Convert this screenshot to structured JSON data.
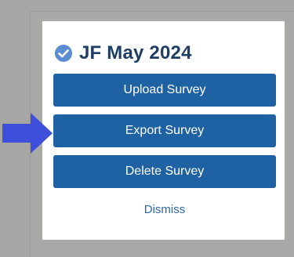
{
  "dialog": {
    "title": "JF May 2024",
    "buttons": {
      "upload": "Upload Survey",
      "export": "Export Survey",
      "delete": "Delete Survey"
    },
    "dismiss": "Dismiss"
  },
  "colors": {
    "button_bg": "#1e62a4",
    "title_text": "#1f3e66",
    "check_icon": "#5b8bd1",
    "pointer_arrow": "#3d4fdb"
  },
  "icons": {
    "title_icon": "check-circle-icon",
    "pointer": "arrow-right-icon"
  }
}
